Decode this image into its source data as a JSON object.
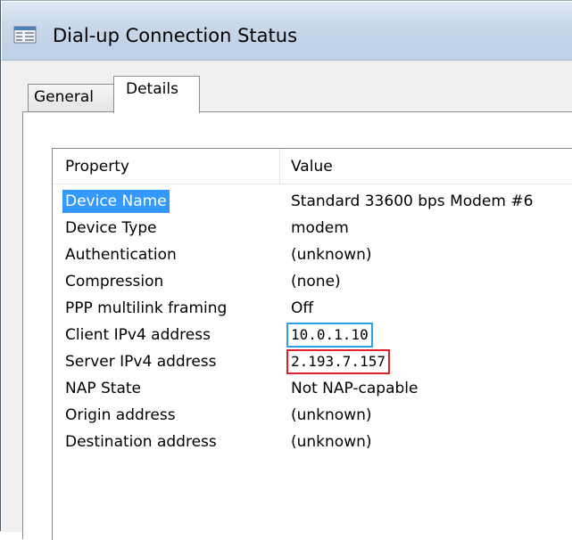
{
  "window": {
    "title": "Dial-up Connection Status",
    "icon": "network-connection-icon"
  },
  "tabs": [
    {
      "label": "General",
      "selected": false
    },
    {
      "label": "Details",
      "selected": true
    }
  ],
  "details": {
    "columns": {
      "property": "Property",
      "value": "Value"
    },
    "rows": [
      {
        "property": "Device Name",
        "value": "Standard 33600 bps Modem #6",
        "selected": true
      },
      {
        "property": "Device Type",
        "value": "modem"
      },
      {
        "property": "Authentication",
        "value": "(unknown)"
      },
      {
        "property": "Compression",
        "value": "(none)"
      },
      {
        "property": "PPP multilink framing",
        "value": "Off"
      },
      {
        "property": "Client IPv4 address",
        "value": "10.0.1.10",
        "highlight": "blue"
      },
      {
        "property": "Server IPv4 address",
        "value": "2.193.7.157",
        "highlight": "red"
      },
      {
        "property": "NAP State",
        "value": "Not NAP-capable"
      },
      {
        "property": "Origin address",
        "value": "(unknown)"
      },
      {
        "property": "Destination address",
        "value": "(unknown)"
      }
    ]
  },
  "colors": {
    "selection": "#3399ff",
    "highlight_blue": "#29a3e3",
    "highlight_red": "#e0202a"
  }
}
